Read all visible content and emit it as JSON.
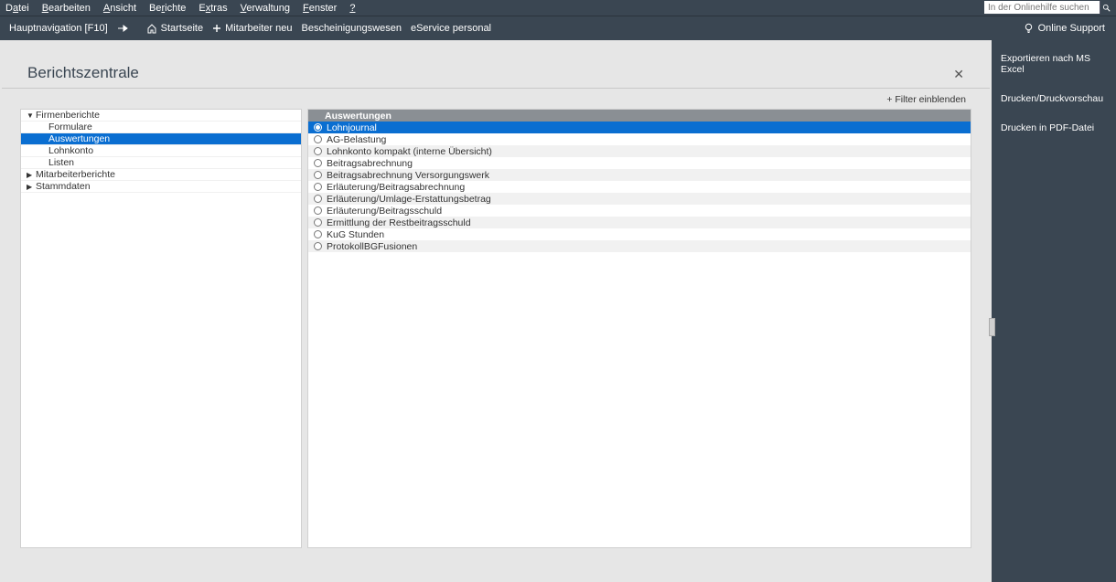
{
  "menubar": {
    "items": [
      {
        "pre": "D",
        "ul": "a",
        "post": "tei"
      },
      {
        "pre": "",
        "ul": "B",
        "post": "earbeiten"
      },
      {
        "pre": "",
        "ul": "A",
        "post": "nsicht"
      },
      {
        "pre": "Be",
        "ul": "r",
        "post": "ichte"
      },
      {
        "pre": "E",
        "ul": "x",
        "post": "tras"
      },
      {
        "pre": "",
        "ul": "V",
        "post": "erwaltung"
      },
      {
        "pre": "",
        "ul": "F",
        "post": "enster"
      },
      {
        "pre": "",
        "ul": "?",
        "post": ""
      }
    ],
    "search_placeholder": "In der Onlinehilfe suchen"
  },
  "subbar": {
    "nav_label": "Hauptnavigation [F10]",
    "items": [
      {
        "label": "Startseite",
        "icon": "home"
      },
      {
        "label": "Mitarbeiter neu",
        "icon": "plus"
      },
      {
        "label": "Bescheinigungswesen",
        "icon": ""
      },
      {
        "label": "eService personal",
        "icon": ""
      }
    ],
    "support_label": "Online Support"
  },
  "page": {
    "title": "Berichtszentrale",
    "filter_label": "+ Filter einblenden"
  },
  "tree": {
    "groups": [
      {
        "label": "Firmenberichte",
        "expanded": true,
        "children": [
          {
            "label": "Formulare",
            "selected": false
          },
          {
            "label": "Auswertungen",
            "selected": true
          },
          {
            "label": "Lohnkonto",
            "selected": false
          },
          {
            "label": "Listen",
            "selected": false
          }
        ]
      },
      {
        "label": "Mitarbeiterberichte",
        "expanded": false,
        "children": []
      },
      {
        "label": "Stammdaten",
        "expanded": false,
        "children": []
      }
    ]
  },
  "list": {
    "header": "Auswertungen",
    "items": [
      {
        "label": "Lohnjournal",
        "selected": true
      },
      {
        "label": "AG-Belastung",
        "selected": false
      },
      {
        "label": "Lohnkonto kompakt (interne Übersicht)",
        "selected": false
      },
      {
        "label": "Beitragsabrechnung",
        "selected": false
      },
      {
        "label": "Beitragsabrechnung Versorgungswerk",
        "selected": false
      },
      {
        "label": "Erläuterung/Beitragsabrechnung",
        "selected": false
      },
      {
        "label": "Erläuterung/Umlage-Erstattungsbetrag",
        "selected": false
      },
      {
        "label": "Erläuterung/Beitragsschuld",
        "selected": false
      },
      {
        "label": "Ermittlung der Restbeitragsschuld",
        "selected": false
      },
      {
        "label": "KuG Stunden",
        "selected": false
      },
      {
        "label": "ProtokollBGFusionen",
        "selected": false
      }
    ]
  },
  "rightpanel": {
    "items": [
      {
        "label": "Exportieren nach MS Excel"
      },
      {
        "label": "Drucken/Druckvorschau"
      },
      {
        "label": "Drucken in PDF-Datei"
      }
    ]
  }
}
